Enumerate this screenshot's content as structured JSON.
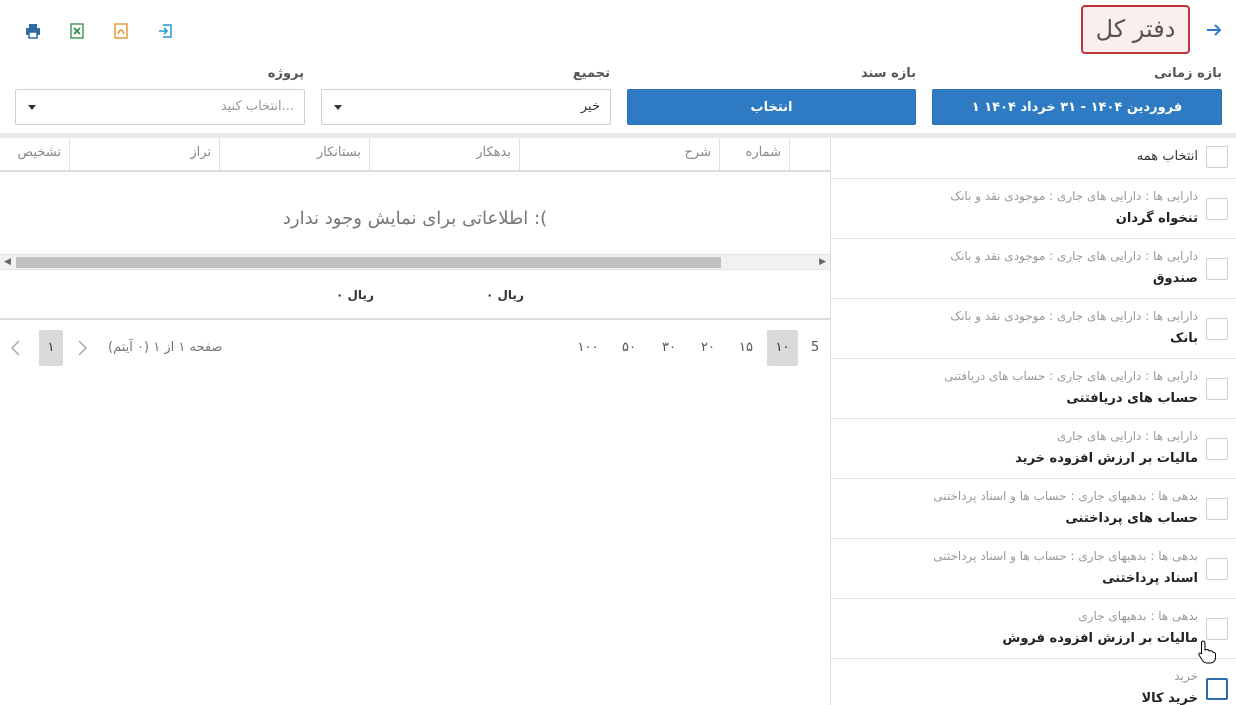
{
  "header": {
    "title": "دفتر کل",
    "back_icon": "arrow-right-icon",
    "toolbar": [
      {
        "name": "print-icon",
        "color": "#2c6aa0"
      },
      {
        "name": "excel-icon",
        "color": "#2e8b3e"
      },
      {
        "name": "pdf-icon",
        "color": "#e08a1e"
      },
      {
        "name": "export-icon",
        "color": "#1f9ad6"
      }
    ]
  },
  "filters": {
    "date_range_label": "بازه زمانی",
    "date_range_value": "۱ فروردین ۱۴۰۴ - ۳۱ خرداد ۱۴۰۴",
    "doc_range_label": "بازه سند",
    "doc_range_value": "انتخاب",
    "aggregate_label": "تجمیع",
    "aggregate_value": "خیر",
    "project_label": "پروژه",
    "project_placeholder": "انتخاب کنید..."
  },
  "grid": {
    "columns": [
      "شماره",
      "شرح",
      "بدهکار",
      "بستانکار",
      "تراز",
      "تشخیص"
    ],
    "empty_message": "اطلاعاتی برای نمایش وجود ندارد :(",
    "totals": {
      "debit": "۰ ریال",
      "credit": "۰ ریال"
    }
  },
  "pager": {
    "page_sizes": [
      "5",
      "۱۰",
      "۱۵",
      "۲۰",
      "۳۰",
      "۵۰",
      "۱۰۰"
    ],
    "active_page_size": "۱۰",
    "info": "صفحه ۱ از ۱ (۰ آیتم)",
    "current_page": "۱"
  },
  "accounts": {
    "select_all_label": "انتخاب همه",
    "items": [
      {
        "path": "دارایی ها : دارایی های جاری : موجودی نقد و بانک",
        "name": "تنخواه گردان"
      },
      {
        "path": "دارایی ها : دارایی های جاری : موجودی نقد و بانک",
        "name": "صندوق"
      },
      {
        "path": "دارایی ها : دارایی های جاری : موجودی نقد و بانک",
        "name": "بانک"
      },
      {
        "path": "دارایی ها : دارایی های جاری : حساب های دریافتنی",
        "name": "حساب های دریافتنی"
      },
      {
        "path": "دارایی ها : دارایی های جاری",
        "name": "مالیات بر ارزش افزوده خرید"
      },
      {
        "path": "بدهی ها : بدهیهای جاری : حساب ها و اسناد پرداختنی",
        "name": "حساب های پرداختنی"
      },
      {
        "path": "بدهی ها : بدهیهای جاری : حساب ها و اسناد پرداختنی",
        "name": "اسناد پرداختنی"
      },
      {
        "path": "بدهی ها : بدهیهای جاری",
        "name": "مالیات بر ارزش افزوده فروش"
      },
      {
        "path": "خرید",
        "name": "خرید کالا"
      }
    ]
  },
  "colors": {
    "primary": "#2e7bc4",
    "title_border": "#c0363a"
  }
}
